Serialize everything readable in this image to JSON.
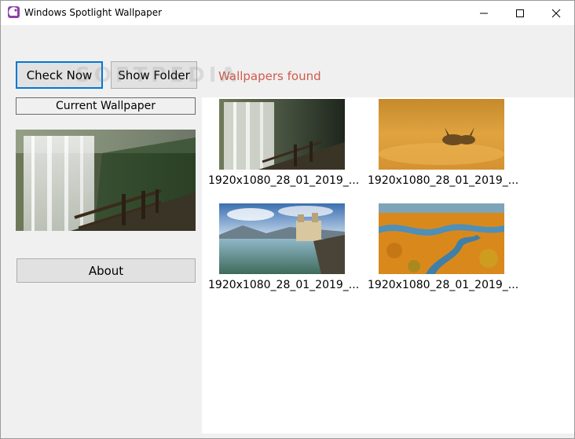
{
  "window": {
    "title": "Windows Spotlight Wallpaper",
    "icon": "app-icon",
    "controls": [
      "minimize-icon",
      "maximize-icon",
      "close-icon"
    ]
  },
  "toolbar": {
    "check_now_label": "Check Now",
    "show_folder_label": "Show Folder",
    "status_text": "Wallpapers found"
  },
  "sidebar": {
    "current_wallpaper_label": "Current Wallpaper",
    "about_label": "About"
  },
  "wallpapers": [
    {
      "caption": "1920x1080_28_01_2019_...",
      "subject": "waterfall forest path"
    },
    {
      "caption": "1920x1080_28_01_2019_...",
      "subject": "hares in golden field"
    },
    {
      "caption": "1920x1080_28_01_2019_...",
      "subject": "lakeside castle"
    },
    {
      "caption": "1920x1080_28_01_2019_...",
      "subject": "autumn river aerial"
    }
  ],
  "watermark": "SOFTPEDIA",
  "colors": {
    "accent": "#0078d7",
    "status_text": "#d05a4a",
    "window_bg": "#f0f0f0",
    "gallery_bg": "#ffffff"
  }
}
